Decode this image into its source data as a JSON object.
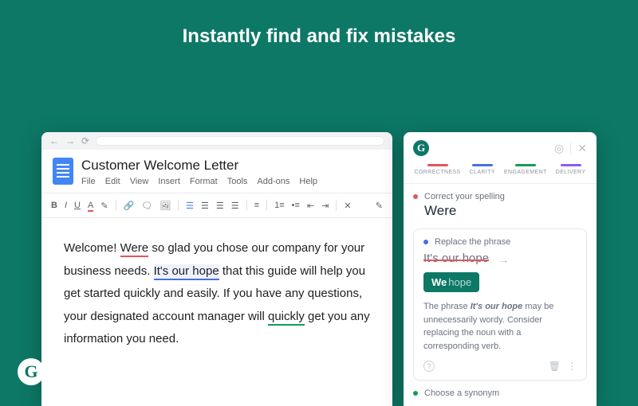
{
  "headline": "Instantly find and fix mistakes",
  "doc": {
    "title": "Customer Welcome Letter",
    "menus": [
      "File",
      "Edit",
      "View",
      "Insert",
      "Format",
      "Tools",
      "Add-ons",
      "Help"
    ],
    "body": {
      "pre1": "Welcome! ",
      "err1": "Were",
      "post1": " so glad you chose our company for your business needs. ",
      "err2": "It's our hope",
      "post2": " that this guide will help you get started quickly and easily. If you have any questions, your designated account manager will ",
      "err3": "quickly",
      "post3": " get you any information you need."
    }
  },
  "panel": {
    "tabs": [
      "CORRECTNESS",
      "CLARITY",
      "ENGAGEMENT",
      "DELIVERY"
    ],
    "card1": {
      "label": "Correct your spelling",
      "word": "Were"
    },
    "card2": {
      "label": "Replace the phrase",
      "strike": "It's our hope",
      "chip_main": "We",
      "chip_rest": "hope",
      "explain_pre": "The phrase ",
      "explain_em": "It's our hope",
      "explain_post": " may be unnecessarily wordy. Consider replacing the noun with a corresponding verb."
    },
    "card3": {
      "label": "Choose a synonym"
    }
  }
}
